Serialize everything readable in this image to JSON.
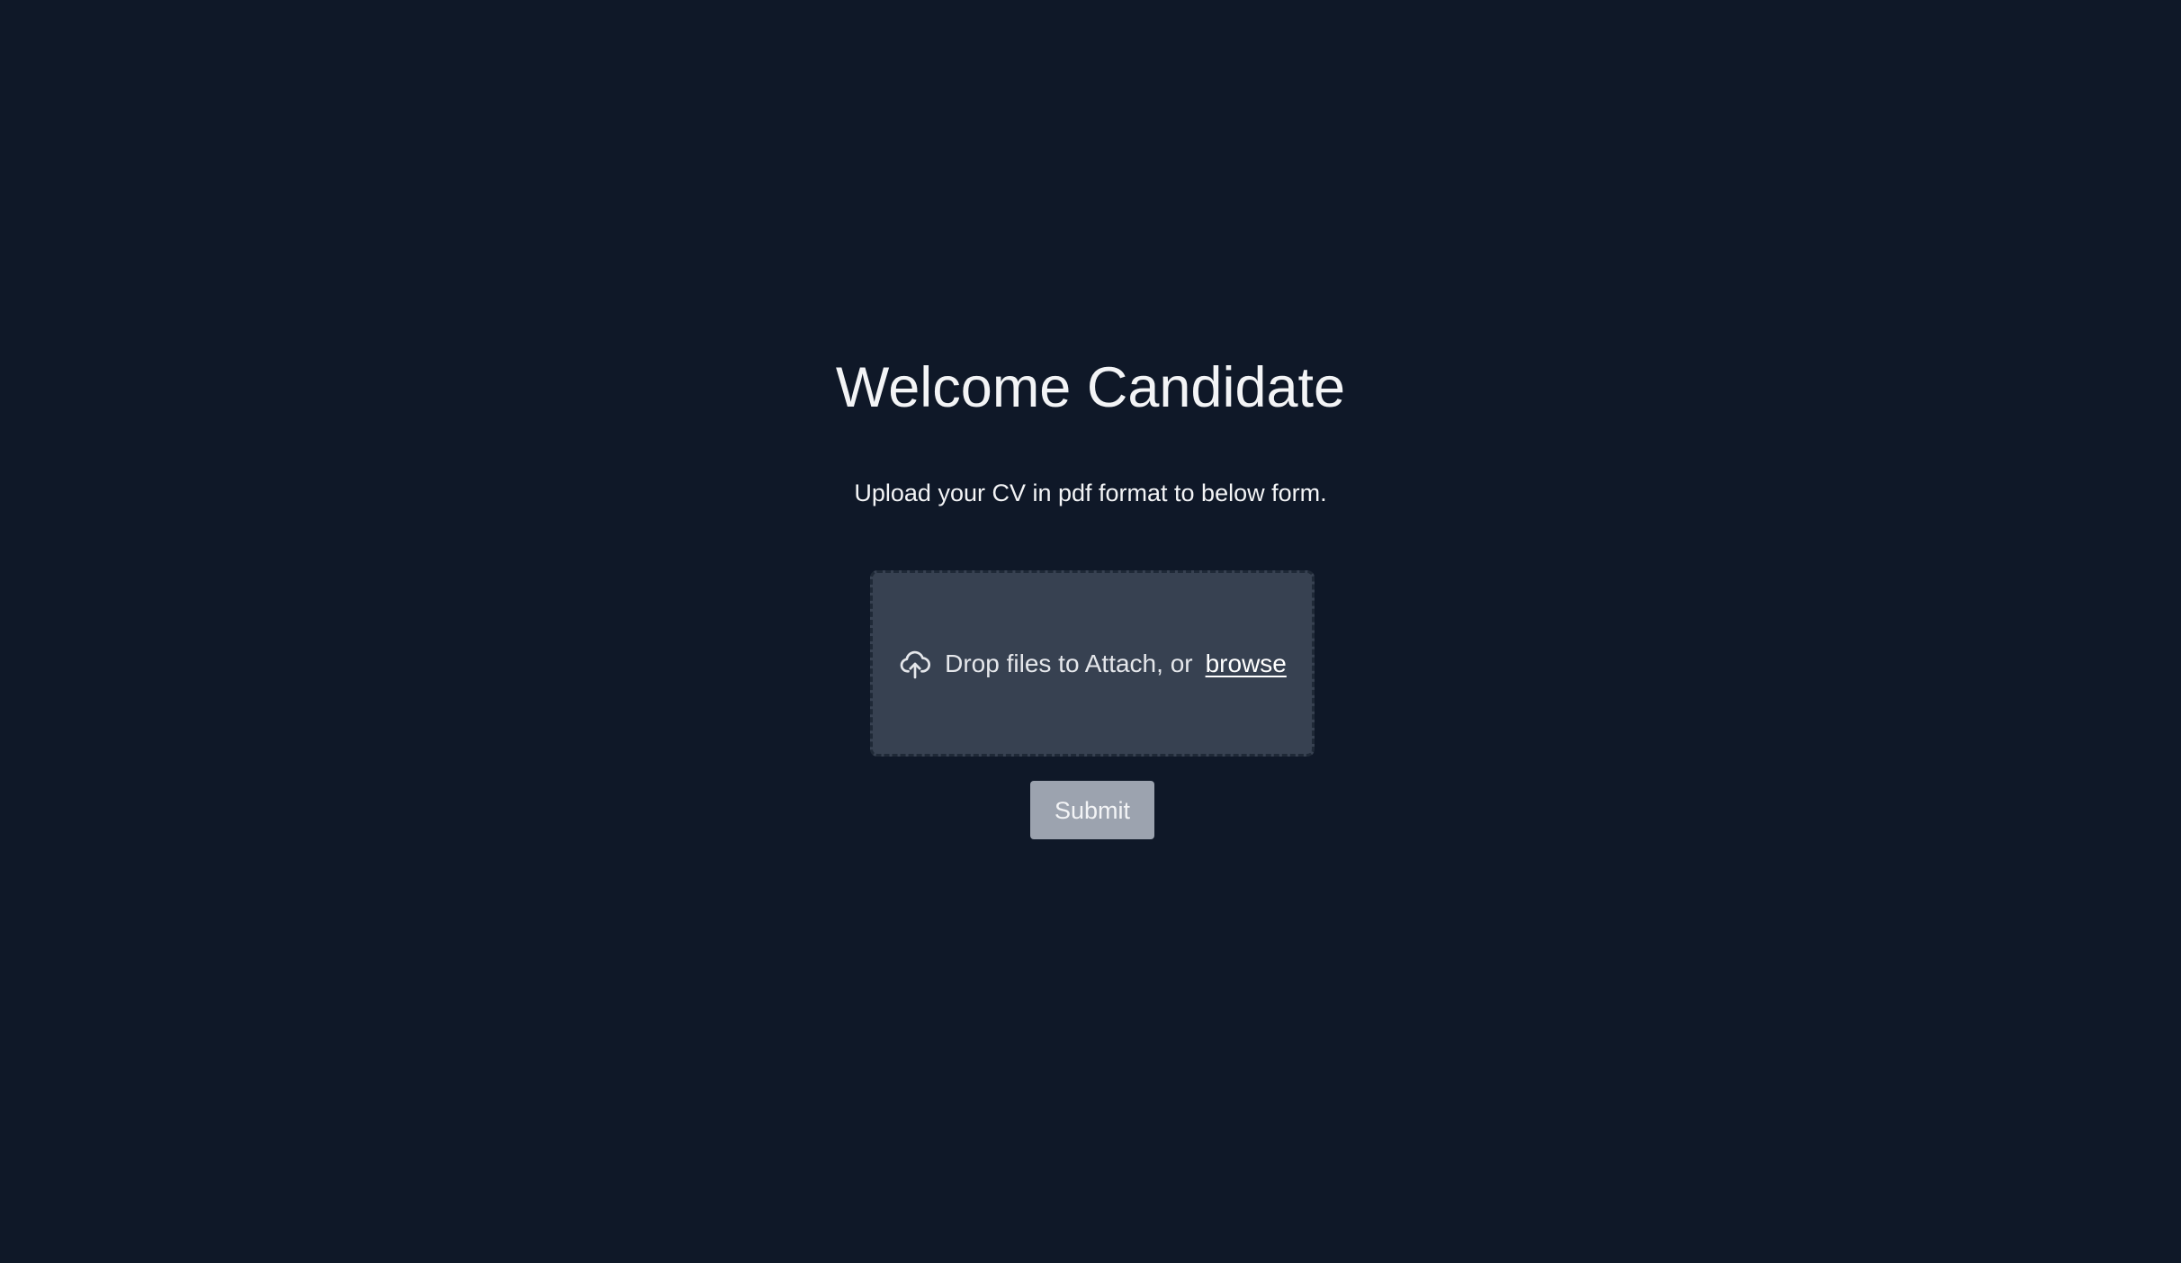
{
  "page": {
    "title": "Welcome Candidate",
    "subtitle": "Upload your CV in pdf format to below form."
  },
  "upload": {
    "icon": "cloud-upload-icon",
    "prompt": "Drop files to Attach, or",
    "browse_label": "browse"
  },
  "form": {
    "submit_label": "Submit"
  },
  "colors": {
    "background": "#0f1828",
    "dropzone": "#374151",
    "submit_button": "#9ca3af",
    "text": "#f3f4f6"
  }
}
